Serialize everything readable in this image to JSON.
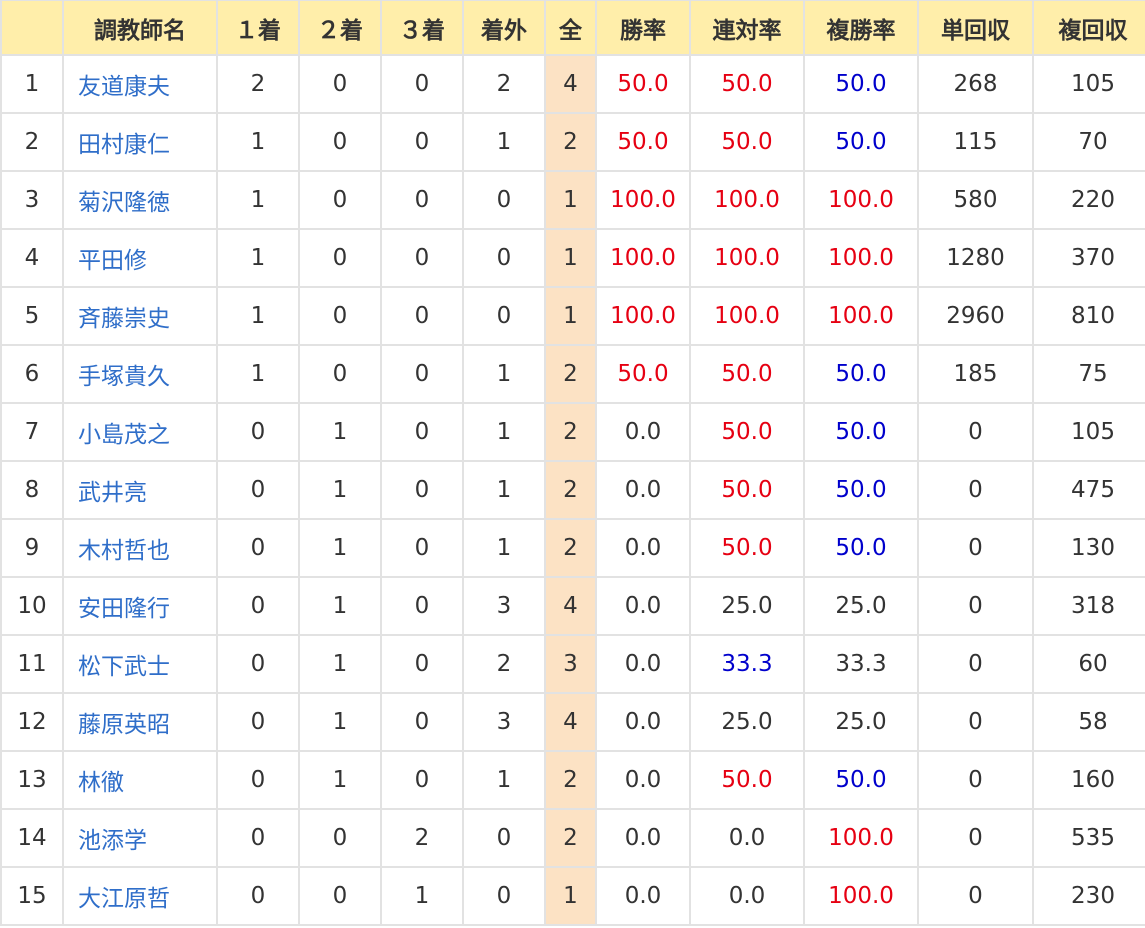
{
  "table": {
    "headers": [
      "",
      "調教師名",
      "１着",
      "２着",
      "３着",
      "着外",
      "全",
      "勝率",
      "連対率",
      "複勝率",
      "単回収",
      "複回収"
    ],
    "colors": {
      "red": "#e60012",
      "blue": "#0000cc",
      "link": "#2f6ec9",
      "header_bg": "#ffeeaa",
      "total_bg": "#fce2c4"
    },
    "rows": [
      {
        "rank": "1",
        "name": "友道康夫",
        "w1": "2",
        "w2": "0",
        "w3": "0",
        "out": "2",
        "total": "4",
        "win_rate": "50.0",
        "win_rate_color": "red",
        "place_rate": "50.0",
        "place_rate_color": "red",
        "show_rate": "50.0",
        "show_rate_color": "blue",
        "win_return": "268",
        "show_return": "105"
      },
      {
        "rank": "2",
        "name": "田村康仁",
        "w1": "1",
        "w2": "0",
        "w3": "0",
        "out": "1",
        "total": "2",
        "win_rate": "50.0",
        "win_rate_color": "red",
        "place_rate": "50.0",
        "place_rate_color": "red",
        "show_rate": "50.0",
        "show_rate_color": "blue",
        "win_return": "115",
        "show_return": "70"
      },
      {
        "rank": "3",
        "name": "菊沢隆徳",
        "w1": "1",
        "w2": "0",
        "w3": "0",
        "out": "0",
        "total": "1",
        "win_rate": "100.0",
        "win_rate_color": "red",
        "place_rate": "100.0",
        "place_rate_color": "red",
        "show_rate": "100.0",
        "show_rate_color": "red",
        "win_return": "580",
        "show_return": "220"
      },
      {
        "rank": "4",
        "name": "平田修",
        "w1": "1",
        "w2": "0",
        "w3": "0",
        "out": "0",
        "total": "1",
        "win_rate": "100.0",
        "win_rate_color": "red",
        "place_rate": "100.0",
        "place_rate_color": "red",
        "show_rate": "100.0",
        "show_rate_color": "red",
        "win_return": "1280",
        "show_return": "370"
      },
      {
        "rank": "5",
        "name": "斉藤崇史",
        "w1": "1",
        "w2": "0",
        "w3": "0",
        "out": "0",
        "total": "1",
        "win_rate": "100.0",
        "win_rate_color": "red",
        "place_rate": "100.0",
        "place_rate_color": "red",
        "show_rate": "100.0",
        "show_rate_color": "red",
        "win_return": "2960",
        "show_return": "810"
      },
      {
        "rank": "6",
        "name": "手塚貴久",
        "w1": "1",
        "w2": "0",
        "w3": "0",
        "out": "1",
        "total": "2",
        "win_rate": "50.0",
        "win_rate_color": "red",
        "place_rate": "50.0",
        "place_rate_color": "red",
        "show_rate": "50.0",
        "show_rate_color": "blue",
        "win_return": "185",
        "show_return": "75"
      },
      {
        "rank": "7",
        "name": "小島茂之",
        "w1": "0",
        "w2": "1",
        "w3": "0",
        "out": "1",
        "total": "2",
        "win_rate": "0.0",
        "win_rate_color": "",
        "place_rate": "50.0",
        "place_rate_color": "red",
        "show_rate": "50.0",
        "show_rate_color": "blue",
        "win_return": "0",
        "show_return": "105"
      },
      {
        "rank": "8",
        "name": "武井亮",
        "w1": "0",
        "w2": "1",
        "w3": "0",
        "out": "1",
        "total": "2",
        "win_rate": "0.0",
        "win_rate_color": "",
        "place_rate": "50.0",
        "place_rate_color": "red",
        "show_rate": "50.0",
        "show_rate_color": "blue",
        "win_return": "0",
        "show_return": "475"
      },
      {
        "rank": "9",
        "name": "木村哲也",
        "w1": "0",
        "w2": "1",
        "w3": "0",
        "out": "1",
        "total": "2",
        "win_rate": "0.0",
        "win_rate_color": "",
        "place_rate": "50.0",
        "place_rate_color": "red",
        "show_rate": "50.0",
        "show_rate_color": "blue",
        "win_return": "0",
        "show_return": "130"
      },
      {
        "rank": "10",
        "name": "安田隆行",
        "w1": "0",
        "w2": "1",
        "w3": "0",
        "out": "3",
        "total": "4",
        "win_rate": "0.0",
        "win_rate_color": "",
        "place_rate": "25.0",
        "place_rate_color": "",
        "show_rate": "25.0",
        "show_rate_color": "",
        "win_return": "0",
        "show_return": "318"
      },
      {
        "rank": "11",
        "name": "松下武士",
        "w1": "0",
        "w2": "1",
        "w3": "0",
        "out": "2",
        "total": "3",
        "win_rate": "0.0",
        "win_rate_color": "",
        "place_rate": "33.3",
        "place_rate_color": "blue",
        "show_rate": "33.3",
        "show_rate_color": "",
        "win_return": "0",
        "show_return": "60"
      },
      {
        "rank": "12",
        "name": "藤原英昭",
        "w1": "0",
        "w2": "1",
        "w3": "0",
        "out": "3",
        "total": "4",
        "win_rate": "0.0",
        "win_rate_color": "",
        "place_rate": "25.0",
        "place_rate_color": "",
        "show_rate": "25.0",
        "show_rate_color": "",
        "win_return": "0",
        "show_return": "58"
      },
      {
        "rank": "13",
        "name": "林徹",
        "w1": "0",
        "w2": "1",
        "w3": "0",
        "out": "1",
        "total": "2",
        "win_rate": "0.0",
        "win_rate_color": "",
        "place_rate": "50.0",
        "place_rate_color": "red",
        "show_rate": "50.0",
        "show_rate_color": "blue",
        "win_return": "0",
        "show_return": "160"
      },
      {
        "rank": "14",
        "name": "池添学",
        "w1": "0",
        "w2": "0",
        "w3": "2",
        "out": "0",
        "total": "2",
        "win_rate": "0.0",
        "win_rate_color": "",
        "place_rate": "0.0",
        "place_rate_color": "",
        "show_rate": "100.0",
        "show_rate_color": "red",
        "win_return": "0",
        "show_return": "535"
      },
      {
        "rank": "15",
        "name": "大江原哲",
        "w1": "0",
        "w2": "0",
        "w3": "1",
        "out": "0",
        "total": "1",
        "win_rate": "0.0",
        "win_rate_color": "",
        "place_rate": "0.0",
        "place_rate_color": "",
        "show_rate": "100.0",
        "show_rate_color": "red",
        "win_return": "0",
        "show_return": "230"
      }
    ]
  }
}
